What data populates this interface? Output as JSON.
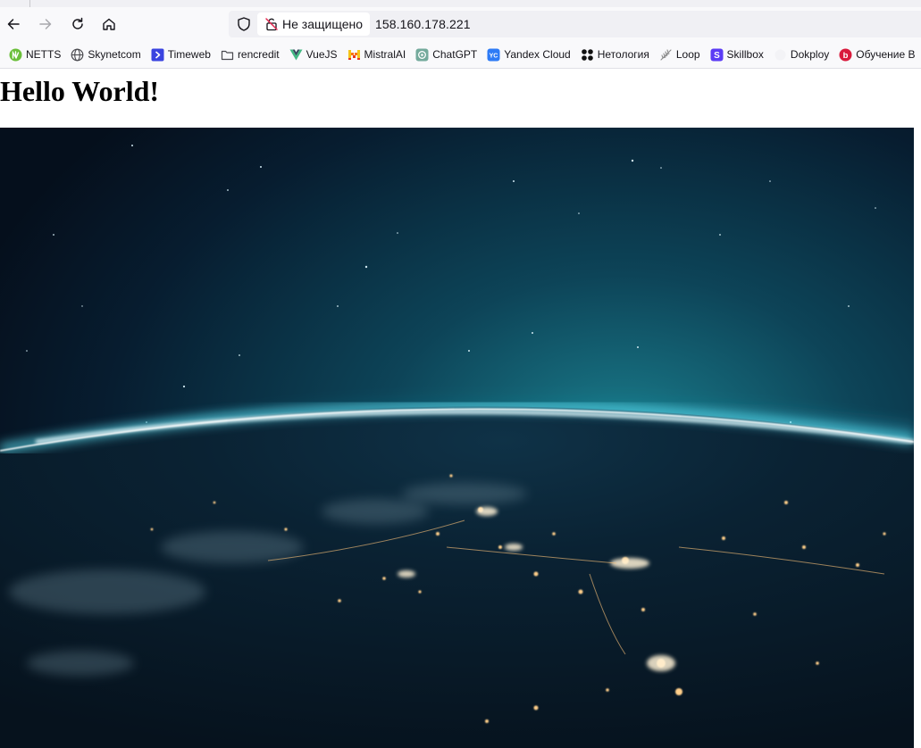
{
  "browser": {
    "security_label": "Не защищено",
    "url": "158.160.178.221"
  },
  "bookmarks": [
    {
      "label": "NETTS",
      "icon": "netts-icon",
      "color": "#6bbf3a"
    },
    {
      "label": "Skynetcom",
      "icon": "globe-icon",
      "color": "#4a4a4f"
    },
    {
      "label": "Timeweb",
      "icon": "timeweb-icon",
      "color": "#3a44e0"
    },
    {
      "label": "rencredit",
      "icon": "folder-icon",
      "color": "#4a4a4f"
    },
    {
      "label": "VueJS",
      "icon": "vue-icon",
      "color": "#42b883"
    },
    {
      "label": "MistralAI",
      "icon": "mistral-icon",
      "color": "#f97316"
    },
    {
      "label": "ChatGPT",
      "icon": "chatgpt-icon",
      "color": "#74aa9c"
    },
    {
      "label": "Yandex Cloud",
      "icon": "yandex-cloud-icon",
      "color": "#2e7bf6"
    },
    {
      "label": "Нетология",
      "icon": "netology-icon",
      "color": "#111111"
    },
    {
      "label": "Loop",
      "icon": "loop-icon",
      "color": "#9a9a9a"
    },
    {
      "label": "Skillbox",
      "icon": "skillbox-icon",
      "color": "#5b3cf5"
    },
    {
      "label": "Dokploy",
      "icon": "dokploy-icon",
      "color": "#dddddd"
    },
    {
      "label": "Обучение B",
      "icon": "obuchenie-icon",
      "color": "#d91a3c"
    }
  ],
  "page": {
    "heading": "Hello World!"
  }
}
